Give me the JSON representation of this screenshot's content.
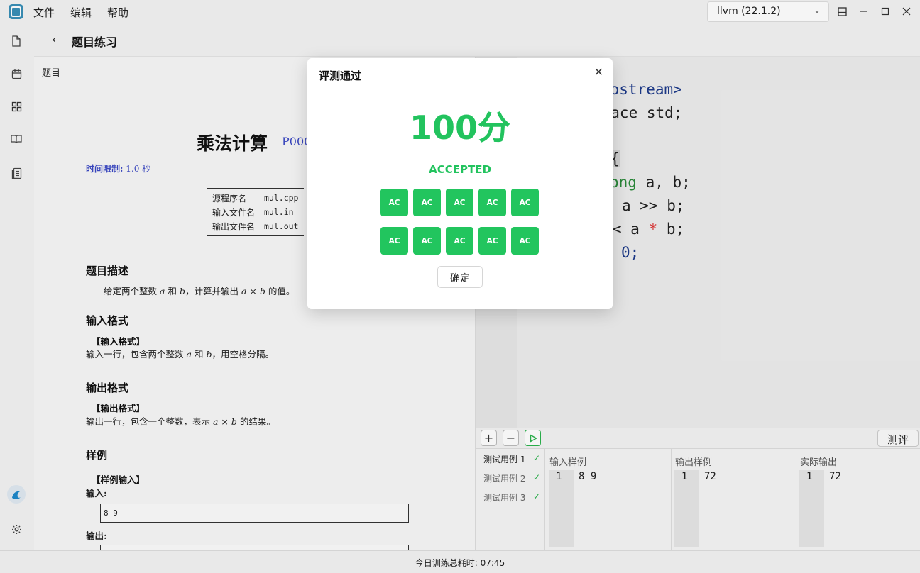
{
  "menu": [
    "文件",
    "编辑",
    "帮助"
  ],
  "compiler": "llvm (22.1.2)",
  "header": {
    "title": "题目练习"
  },
  "problem_tab": "题目",
  "problem": {
    "title": "乘法计算",
    "code": "P000",
    "time_limit_label": "时间限制:",
    "time_limit_value": "1.0 秒",
    "files": [
      {
        "k": "源程序名",
        "v": "mul.cpp"
      },
      {
        "k": "输入文件名",
        "v": "mul.in"
      },
      {
        "k": "输出文件名",
        "v": "mul.out"
      }
    ],
    "desc_heading": "题目描述",
    "desc_pre": "给定两个整数",
    "desc_a": "a",
    "desc_and": "和",
    "desc_b": "b",
    "desc_mid": "，计算并输出",
    "desc_expr": "a × b",
    "desc_post": "的值。",
    "input_heading": "输入格式",
    "input_sub": "【输入格式】",
    "input_pre": "输入一行，包含两个整数",
    "input_post": "，用空格分隔。",
    "output_heading": "输出格式",
    "output_sub": "【输出格式】",
    "output_pre": "输出一行，包含一个整数，表示",
    "output_post": "的结果。",
    "sample_heading": "样例",
    "sample_sub": "【样例输入】",
    "sample_in_label": "输入:",
    "sample_in_value": "8 9",
    "sample_out_label": "输出:"
  },
  "code_lines": [
    "iostream>",
    "space std;",
    "{",
    "ong a, b;",
    "a >> b;",
    "< a * b;",
    "0;"
  ],
  "test_panel": {
    "judge_label": "测评",
    "cases": [
      "测试用例 1",
      "测试用例 2",
      "测试用例 3"
    ],
    "check": "✓",
    "cols": [
      {
        "label": "输入样例",
        "line": "1",
        "value": "8 9"
      },
      {
        "label": "输出样例",
        "line": "1",
        "value": "72"
      },
      {
        "label": "实际输出",
        "line": "1",
        "value": "72"
      }
    ]
  },
  "status": "今日训练总耗时: 07:45",
  "modal": {
    "title": "评测通过",
    "score": "100分",
    "verdict": "ACCEPTED",
    "results": [
      "AC",
      "AC",
      "AC",
      "AC",
      "AC",
      "AC",
      "AC",
      "AC",
      "AC",
      "AC"
    ],
    "ok_label": "确定",
    "accent": "#22c55e"
  }
}
